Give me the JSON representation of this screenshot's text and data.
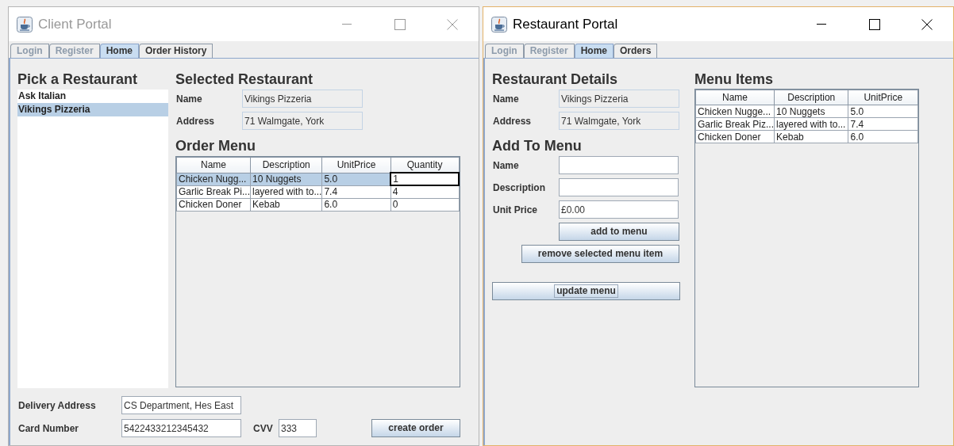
{
  "client_window": {
    "title": "Client Portal",
    "active": false,
    "tabs": [
      {
        "label": "Login",
        "selected": false,
        "disabled": true
      },
      {
        "label": "Register",
        "selected": false,
        "disabled": true
      },
      {
        "label": "Home",
        "selected": true,
        "disabled": false
      },
      {
        "label": "Order History",
        "selected": false,
        "disabled": false
      }
    ],
    "restaurant_picker": {
      "heading": "Pick a Restaurant",
      "items": [
        {
          "label": "Ask Italian",
          "selected": false
        },
        {
          "label": "Vikings Pizzeria",
          "selected": true
        }
      ]
    },
    "selected_restaurant": {
      "heading": "Selected Restaurant",
      "fields": [
        {
          "label": "Name",
          "value": "Vikings Pizzeria",
          "editable": false
        },
        {
          "label": "Address",
          "value": "71 Walmgate, York",
          "editable": false
        }
      ]
    },
    "order_menu": {
      "heading": "Order Menu",
      "columns": [
        "Name",
        "Description",
        "UnitPrice",
        "Quantity"
      ],
      "rows": [
        {
          "cells": [
            "Chicken Nugg...",
            "10 Nuggets",
            "5.0",
            "1"
          ],
          "selected": true,
          "editing": true
        },
        {
          "cells": [
            "Garlic Break Pi...",
            "layered with to...",
            "7.4",
            "4"
          ],
          "selected": false,
          "editing": false
        },
        {
          "cells": [
            "Chicken Doner",
            "Kebab",
            "6.0",
            "0"
          ],
          "selected": false,
          "editing": false
        }
      ]
    },
    "delivery_address": {
      "label": "Delivery Address",
      "value": "CS Department, Hes East",
      "editable": true
    },
    "card_number": {
      "label": "Card Number",
      "value": "5422433212345432",
      "editable": true
    },
    "cvv": {
      "label": "CVV",
      "value": "333",
      "editable": true
    },
    "create_order_button": {
      "label": "create order",
      "focused": false
    }
  },
  "restaurant_window": {
    "title": "Restaurant Portal",
    "active": true,
    "tabs": [
      {
        "label": "Login",
        "selected": false,
        "disabled": true
      },
      {
        "label": "Register",
        "selected": false,
        "disabled": true
      },
      {
        "label": "Home",
        "selected": true,
        "disabled": false
      },
      {
        "label": "Orders",
        "selected": false,
        "disabled": false
      }
    ],
    "restaurant_details": {
      "heading": "Restaurant Details",
      "fields": [
        {
          "label": "Name",
          "value": "Vikings Pizzeria",
          "editable": false
        },
        {
          "label": "Address",
          "value": "71 Walmgate, York",
          "editable": false
        }
      ]
    },
    "add_to_menu": {
      "heading": "Add To Menu",
      "fields": [
        {
          "label": "Name",
          "editable": true
        },
        {
          "label": "Description",
          "editable": true
        },
        {
          "label": "Unit Price",
          "value": "£0.00",
          "editable": true
        }
      ],
      "buttons": [
        {
          "label": "add to menu",
          "focused": false
        },
        {
          "label": "remove selected menu item",
          "focused": false
        },
        {
          "label": "update menu",
          "focused": true
        }
      ]
    },
    "menu_items": {
      "heading": "Menu Items",
      "columns": [
        "Name",
        "Description",
        "UnitPrice"
      ],
      "rows": [
        {
          "cells": [
            "Chicken Nugge...",
            "10 Nuggets",
            "5.0"
          ],
          "selected": false,
          "editing": false
        },
        {
          "cells": [
            "Garlic Break Piz...",
            "layered with to...",
            "7.4"
          ],
          "selected": false,
          "editing": false
        },
        {
          "cells": [
            "Chicken Doner",
            "Kebab",
            "6.0"
          ],
          "selected": false,
          "editing": false
        }
      ]
    }
  }
}
